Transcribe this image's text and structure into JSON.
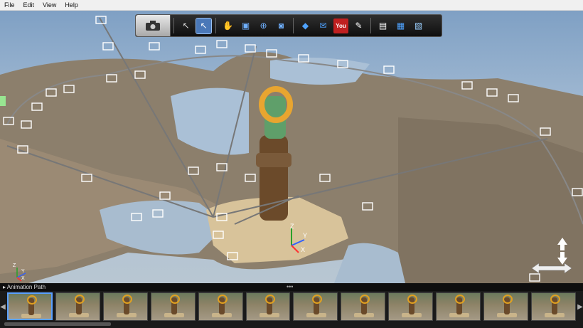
{
  "menu": [
    "File",
    "Edit",
    "View",
    "Help"
  ],
  "toolbar": {
    "camera_icon": "camera-icon",
    "buttons": [
      {
        "name": "select-arrow-icon",
        "glyph": "↖",
        "color": "#dddddd"
      },
      {
        "name": "select-active-icon",
        "glyph": "↖",
        "color": "#ffffff",
        "active": true
      },
      {
        "name": "hand-nav-icon",
        "glyph": "✋",
        "color": "#e0e0e0"
      },
      {
        "name": "camera-move-icon",
        "glyph": "▣",
        "color": "#6fb0ff"
      },
      {
        "name": "orbit-icon",
        "glyph": "⊕",
        "color": "#6fb0ff"
      },
      {
        "name": "snapshot-icon",
        "glyph": "◙",
        "color": "#6fb0ff"
      },
      {
        "name": "diamond-icon",
        "glyph": "◆",
        "color": "#4fa3ff"
      },
      {
        "name": "email-icon",
        "glyph": "✉",
        "color": "#4fa3ff"
      },
      {
        "name": "youtube-icon",
        "glyph": "You",
        "color": "#ffffff"
      },
      {
        "name": "edit-pen-icon",
        "glyph": "✎",
        "color": "#ffffff"
      },
      {
        "name": "export-icon",
        "glyph": "▤",
        "color": "#ffffff"
      },
      {
        "name": "cube-share-icon",
        "glyph": "▦",
        "color": "#4fa3ff"
      },
      {
        "name": "document-icon",
        "glyph": "▧",
        "color": "#9cd0ff"
      }
    ]
  },
  "filmstrip": {
    "title": "Animation Path",
    "thumbnail_count": 12
  },
  "axes": {
    "y": "Y",
    "x": "X",
    "z": "Z"
  }
}
